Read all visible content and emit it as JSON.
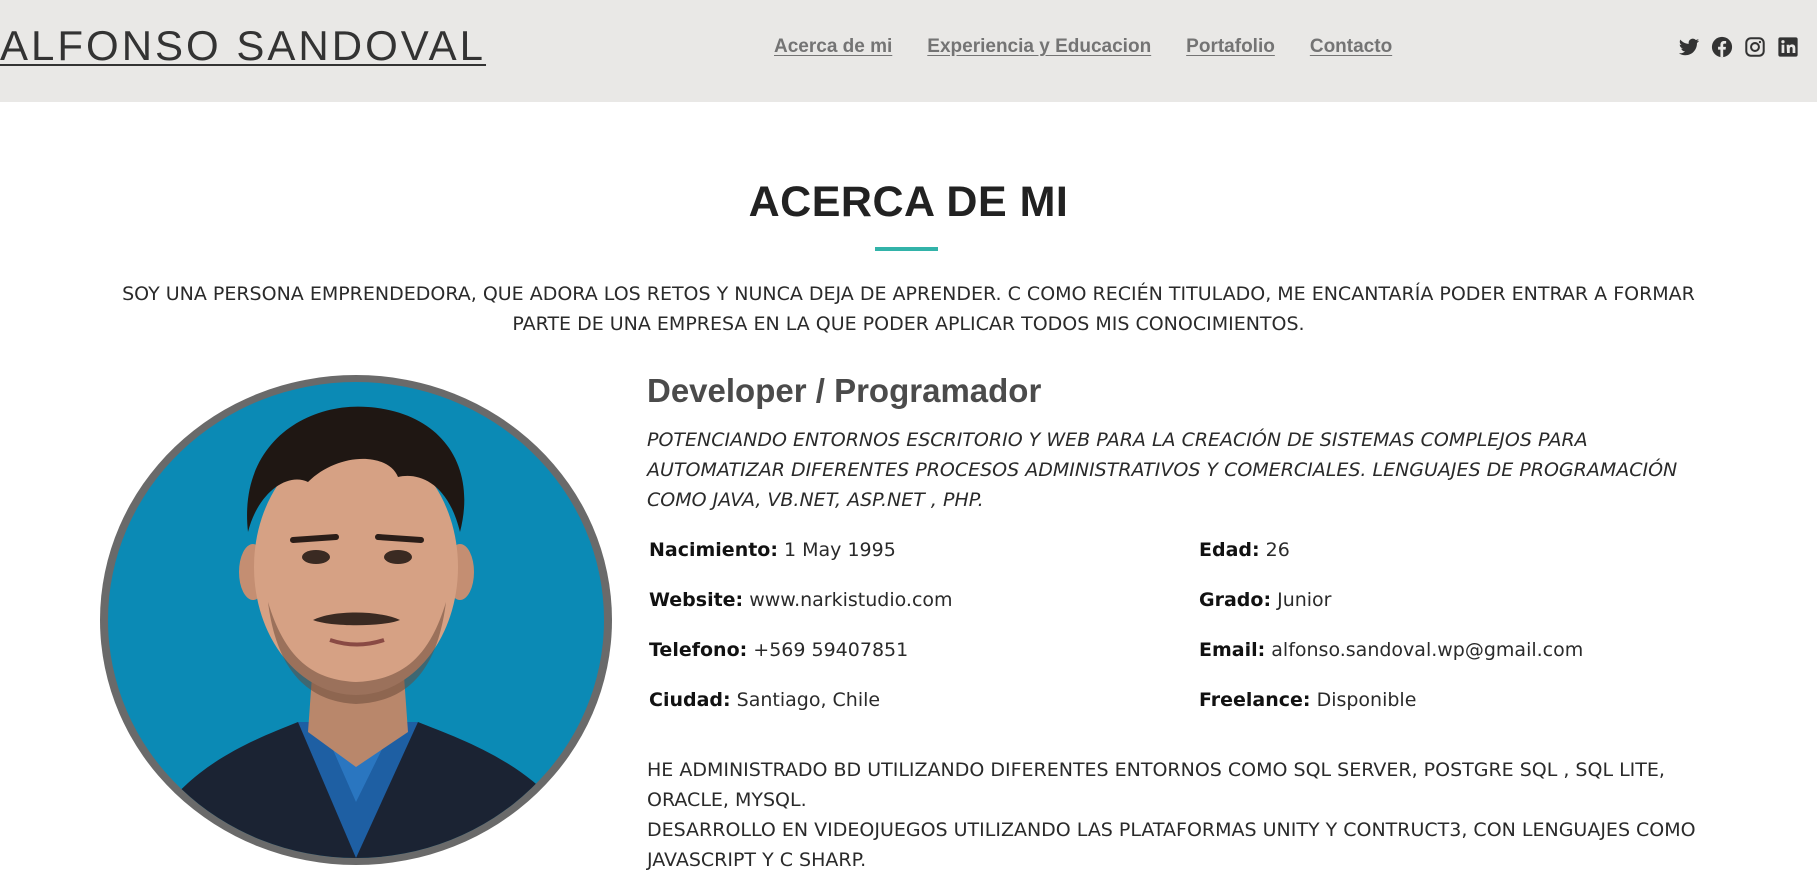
{
  "header": {
    "brand": "ALFONSO SANDOVAL",
    "nav": [
      {
        "label": "Acerca de mi"
      },
      {
        "label": "Experiencia y Educacion"
      },
      {
        "label": "Portafolio"
      },
      {
        "label": "Contacto"
      }
    ],
    "social": [
      "twitter-icon",
      "facebook-icon",
      "instagram-icon",
      "linkedin-icon"
    ]
  },
  "about": {
    "title": "ACERCA DE MI",
    "intro": "SOY UNA PERSONA EMPRENDEDORA, QUE ADORA LOS RETOS Y NUNCA DEJA DE APRENDER. C COMO RECIÉN TITULADO, ME ENCANTARÍA PODER ENTRAR A FORMAR PARTE DE UNA EMPRESA EN LA QUE PODER APLICAR TODOS MIS CONOCIMIENTOS.",
    "role": "Developer / Programador",
    "tagline": "POTENCIANDO ENTORNOS ESCRITORIO Y WEB PARA LA CREACIÓN DE SISTEMAS COMPLEJOS PARA AUTOMATIZAR DIFERENTES PROCESOS ADMINISTRATIVOS Y COMERCIALES. LENGUAJES DE PROGRAMACIÓN COMO JAVA, VB.NET, ASP.NET , PHP.",
    "facts": {
      "nacimiento": {
        "label": "Nacimiento:",
        "value": "1 May 1995"
      },
      "edad": {
        "label": "Edad:",
        "value": "26"
      },
      "website": {
        "label": "Website:",
        "value": "www.narkistudio.com"
      },
      "grado": {
        "label": "Grado:",
        "value": "Junior"
      },
      "telefono": {
        "label": "Telefono:",
        "value": "+569 59407851"
      },
      "email": {
        "label": "Email:",
        "value": "alfonso.sandoval.wp@gmail.com"
      },
      "ciudad": {
        "label": "Ciudad:",
        "value": "Santiago, Chile"
      },
      "freelance": {
        "label": "Freelance:",
        "value": "Disponible"
      }
    },
    "body_line1": "HE ADMINISTRADO BD UTILIZANDO DIFERENTES ENTORNOS COMO SQL SERVER, POSTGRE SQL , SQL LITE, ORACLE, MYSQL.",
    "body_line2": "DESARROLLO EN VIDEOJUEGOS UTILIZANDO LAS PLATAFORMAS UNITY Y CONTRUCT3, CON LENGUAJES COMO JAVASCRIPT Y C SHARP."
  },
  "colors": {
    "header_bg": "#e9e8e6",
    "accent": "#32b3a9",
    "photo_bg": "#0b8ab5"
  }
}
